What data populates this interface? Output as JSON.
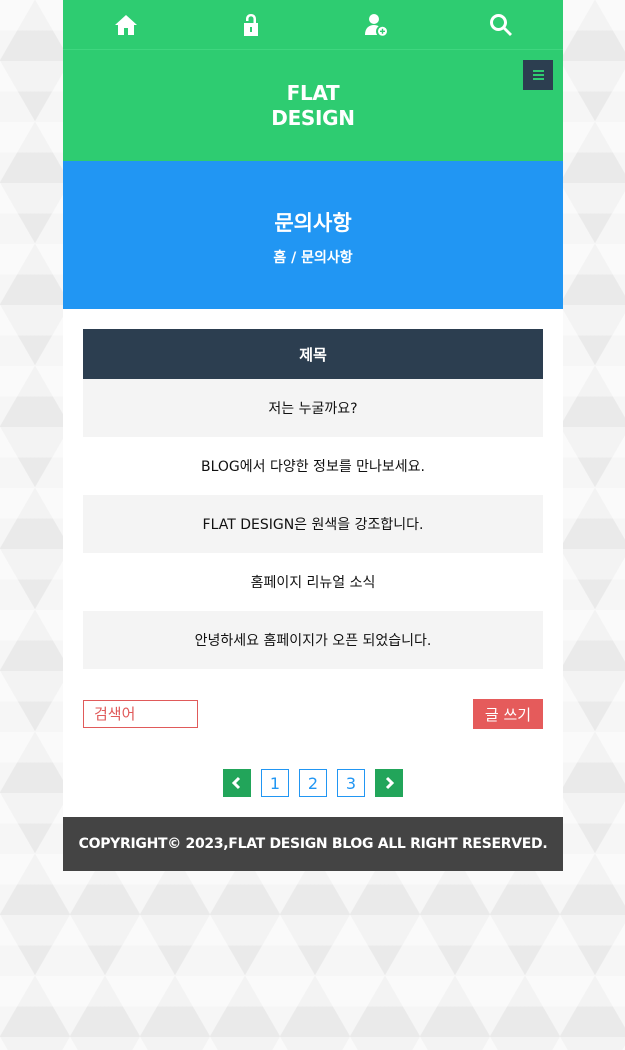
{
  "nav": {
    "items": [
      {
        "icon": "home-icon"
      },
      {
        "icon": "unlock-icon"
      },
      {
        "icon": "add-user-icon"
      },
      {
        "icon": "search-icon"
      }
    ]
  },
  "header": {
    "logo_line1": "FLAT",
    "logo_line2": "DESIGN",
    "menu_icon": "hamburger-menu-icon"
  },
  "banner": {
    "title": "문의사항",
    "breadcrumb": "홈 / 문의사항"
  },
  "board": {
    "column_header": "제목",
    "rows": [
      "저는 누굴까요?",
      "BLOG에서 다양한 정보를 만나보세요.",
      "FLAT DESIGN은 원색을 강조합니다.",
      "홈페이지 리뉴얼 소식",
      "안녕하세요 홈페이지가 오픈 되었습니다."
    ]
  },
  "controls": {
    "search_placeholder": "검색어",
    "write_label": "글 쓰기"
  },
  "pagination": {
    "pages": [
      "1",
      "2",
      "3"
    ]
  },
  "footer": {
    "copyright": "COPYRIGHT© 2023,FLAT DESIGN BLOG ALL RIGHT RESERVED."
  },
  "colors": {
    "green": "#2ecc71",
    "blue": "#2196f3",
    "navy": "#2c3e50",
    "red": "#e55b5b",
    "dark_footer": "#444444"
  }
}
